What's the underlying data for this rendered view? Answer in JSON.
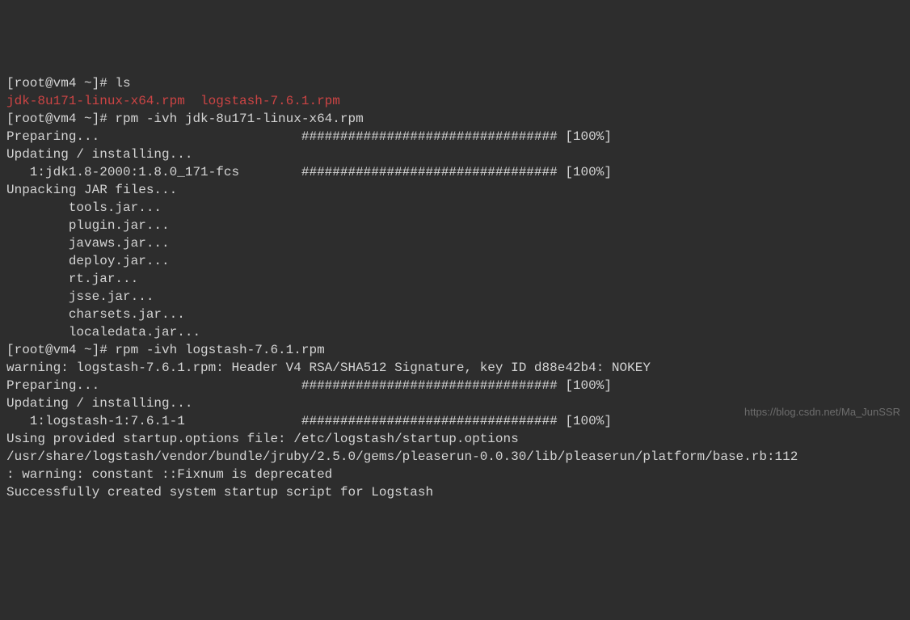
{
  "terminal": {
    "lines": [
      {
        "segments": [
          {
            "text": "[root@vm4 ~]# ls",
            "class": "prompt"
          }
        ]
      },
      {
        "segments": [
          {
            "text": "jdk-8u171-linux-x64.rpm  logstash-7.6.1.rpm",
            "class": "red"
          }
        ]
      },
      {
        "segments": [
          {
            "text": "[root@vm4 ~]# rpm -ivh jdk-8u171-linux-x64.rpm",
            "class": "prompt"
          }
        ]
      },
      {
        "segments": [
          {
            "text": "Preparing...                          ################################# [100%]",
            "class": "white"
          }
        ]
      },
      {
        "segments": [
          {
            "text": "Updating / installing...",
            "class": "white"
          }
        ]
      },
      {
        "segments": [
          {
            "text": "   1:jdk1.8-2000:1.8.0_171-fcs        ################################# [100%]",
            "class": "white"
          }
        ]
      },
      {
        "segments": [
          {
            "text": "Unpacking JAR files...",
            "class": "white"
          }
        ]
      },
      {
        "segments": [
          {
            "text": "        tools.jar...",
            "class": "white"
          }
        ]
      },
      {
        "segments": [
          {
            "text": "        plugin.jar...",
            "class": "white"
          }
        ]
      },
      {
        "segments": [
          {
            "text": "        javaws.jar...",
            "class": "white"
          }
        ]
      },
      {
        "segments": [
          {
            "text": "        deploy.jar...",
            "class": "white"
          }
        ]
      },
      {
        "segments": [
          {
            "text": "        rt.jar...",
            "class": "white"
          }
        ]
      },
      {
        "segments": [
          {
            "text": "        jsse.jar...",
            "class": "white"
          }
        ]
      },
      {
        "segments": [
          {
            "text": "        charsets.jar...",
            "class": "white"
          }
        ]
      },
      {
        "segments": [
          {
            "text": "        localedata.jar...",
            "class": "white"
          }
        ]
      },
      {
        "segments": [
          {
            "text": "[root@vm4 ~]# rpm -ivh logstash-7.6.1.rpm",
            "class": "prompt"
          }
        ]
      },
      {
        "segments": [
          {
            "text": "warning: logstash-7.6.1.rpm: Header V4 RSA/SHA512 Signature, key ID d88e42b4: NOKEY",
            "class": "white"
          }
        ]
      },
      {
        "segments": [
          {
            "text": "Preparing...                          ################################# [100%]",
            "class": "white"
          }
        ]
      },
      {
        "segments": [
          {
            "text": "Updating / installing...",
            "class": "white"
          }
        ]
      },
      {
        "segments": [
          {
            "text": "   1:logstash-1:7.6.1-1               ################################# [100%]",
            "class": "white"
          }
        ]
      },
      {
        "segments": [
          {
            "text": "Using provided startup.options file: /etc/logstash/startup.options",
            "class": "white"
          }
        ]
      },
      {
        "segments": [
          {
            "text": "/usr/share/logstash/vendor/bundle/jruby/2.5.0/gems/pleaserun-0.0.30/lib/pleaserun/platform/base.rb:112",
            "class": "white"
          }
        ]
      },
      {
        "segments": [
          {
            "text": ": warning: constant ::Fixnum is deprecated",
            "class": "white"
          }
        ]
      },
      {
        "segments": [
          {
            "text": "Successfully created system startup script for Logstash",
            "class": "white"
          }
        ]
      }
    ]
  },
  "watermark": "https://blog.csdn.net/Ma_JunSSR"
}
